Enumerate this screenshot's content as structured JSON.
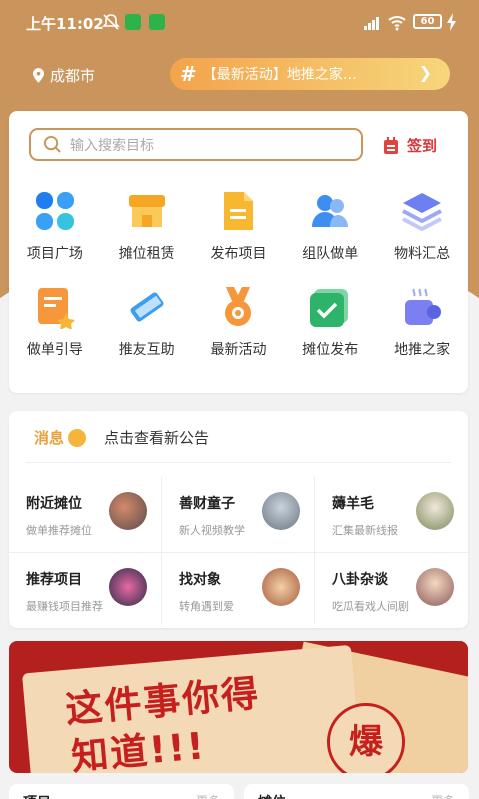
{
  "status_bar": {
    "time": "上午11:02",
    "battery": "60"
  },
  "header": {
    "city": "成都市",
    "notice_text": "【最新活动】地推之家…"
  },
  "search": {
    "placeholder": "输入搜索目标",
    "signin_label": "签到"
  },
  "grid": [
    {
      "label": "项目广场",
      "icon": "clover-icon",
      "color": "#1e7ef0"
    },
    {
      "label": "摊位租赁",
      "icon": "stall-icon",
      "color": "#f5a623"
    },
    {
      "label": "发布项目",
      "icon": "document-icon",
      "color": "#f7b731"
    },
    {
      "label": "组队做单",
      "icon": "team-icon",
      "color": "#3d8ef0"
    },
    {
      "label": "物料汇总",
      "icon": "layers-icon",
      "color": "#6e7ff3"
    },
    {
      "label": "做单引导",
      "icon": "guide-icon",
      "color": "#f5973a"
    },
    {
      "label": "推友互助",
      "icon": "ruler-icon",
      "color": "#3d9df0"
    },
    {
      "label": "最新活动",
      "icon": "medal-icon",
      "color": "#f5973a"
    },
    {
      "label": "摊位发布",
      "icon": "check-icon",
      "color": "#2db36a"
    },
    {
      "label": "地推之家",
      "icon": "cup-icon",
      "color": "#7b7ff0"
    }
  ],
  "news": {
    "tag": "消息",
    "headline": "点击查看新公告",
    "cells": [
      {
        "title": "附近摊位",
        "subtitle": "做单推荐摊位"
      },
      {
        "title": "善财童子",
        "subtitle": "新人视频教学"
      },
      {
        "title": "薅羊毛",
        "subtitle": "汇集最新线报"
      },
      {
        "title": "推荐项目",
        "subtitle": "最赚钱项目推荐"
      },
      {
        "title": "找对象",
        "subtitle": "转角遇到爱"
      },
      {
        "title": "八卦杂谈",
        "subtitle": "吃瓜看戏人间剧"
      }
    ]
  },
  "banner": {
    "line1": "这件事你得",
    "line2": "知道!!!",
    "badge": "爆"
  },
  "bottom": {
    "left_title": "项目",
    "left_sub": "更多",
    "right_title": "摊位",
    "right_sub": "更多"
  }
}
